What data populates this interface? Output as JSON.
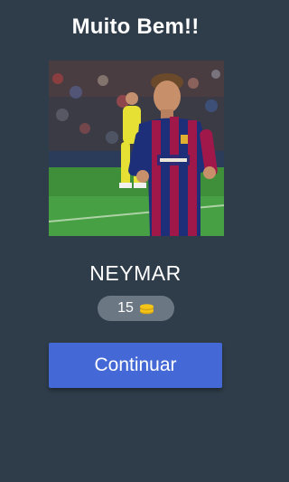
{
  "header": {
    "title": "Muito Bem!!"
  },
  "result": {
    "answer": "NEYMAR",
    "coins_value": "15",
    "coin_icon": "coin-stack-icon"
  },
  "actions": {
    "continue_label": "Continuar"
  },
  "colors": {
    "background": "#2f3d4a",
    "button": "#4469d6",
    "badge": "#6b7884",
    "coin": "#f5c518"
  }
}
